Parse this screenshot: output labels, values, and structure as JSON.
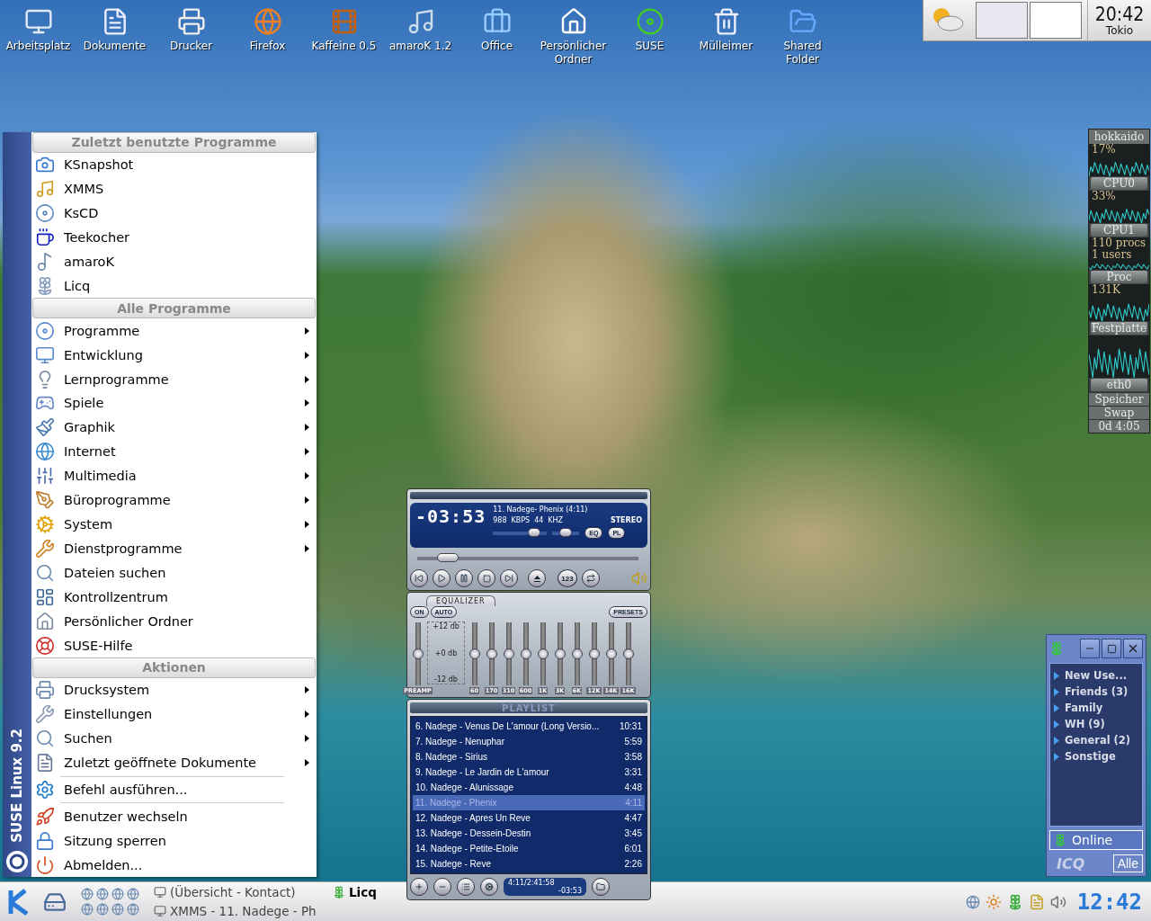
{
  "desktop_icons": [
    {
      "label": "Arbeitsplatz"
    },
    {
      "label": "Dokumente"
    },
    {
      "label": "Drucker"
    },
    {
      "label": "Firefox"
    },
    {
      "label": "Kaffeine 0.5"
    },
    {
      "label": "amaroK 1.2"
    },
    {
      "label": "Office"
    },
    {
      "label": "Persönlicher Ordner"
    },
    {
      "label": "SUSE"
    },
    {
      "label": "Mülleimer"
    },
    {
      "label": "Shared Folder"
    }
  ],
  "top_panel": {
    "time": "20:42",
    "city": "Tokio"
  },
  "kmenu": {
    "side_label": "SUSE Linux 9.2",
    "sections": [
      {
        "title": "Zuletzt benutzte Programme",
        "items": [
          {
            "label": "KSnapshot",
            "submenu": false,
            "separator_before": false
          },
          {
            "label": "XMMS",
            "submenu": false,
            "separator_before": false
          },
          {
            "label": "KsCD",
            "submenu": false,
            "separator_before": false
          },
          {
            "label": "Teekocher",
            "submenu": false,
            "separator_before": false
          },
          {
            "label": "amaroK",
            "submenu": false,
            "separator_before": false
          },
          {
            "label": "Licq",
            "submenu": false,
            "separator_before": false
          }
        ]
      },
      {
        "title": "Alle Programme",
        "items": [
          {
            "label": "Programme",
            "submenu": true,
            "separator_before": false
          },
          {
            "label": "Entwicklung",
            "submenu": true,
            "separator_before": false
          },
          {
            "label": "Lernprogramme",
            "submenu": true,
            "separator_before": false
          },
          {
            "label": "Spiele",
            "submenu": true,
            "separator_before": false
          },
          {
            "label": "Graphik",
            "submenu": true,
            "separator_before": false
          },
          {
            "label": "Internet",
            "submenu": true,
            "separator_before": false
          },
          {
            "label": "Multimedia",
            "submenu": true,
            "separator_before": false
          },
          {
            "label": "Büroprogramme",
            "submenu": true,
            "separator_before": false
          },
          {
            "label": "System",
            "submenu": true,
            "separator_before": false
          },
          {
            "label": "Dienstprogramme",
            "submenu": true,
            "separator_before": false
          },
          {
            "label": "Dateien suchen",
            "submenu": false,
            "separator_before": false
          },
          {
            "label": "Kontrollzentrum",
            "submenu": false,
            "separator_before": false
          },
          {
            "label": "Persönlicher Ordner",
            "submenu": false,
            "separator_before": false
          },
          {
            "label": "SUSE-Hilfe",
            "submenu": false,
            "separator_before": false
          }
        ]
      },
      {
        "title": "Aktionen",
        "items": [
          {
            "label": "Drucksystem",
            "submenu": true,
            "separator_before": false
          },
          {
            "label": "Einstellungen",
            "submenu": true,
            "separator_before": false
          },
          {
            "label": "Suchen",
            "submenu": true,
            "separator_before": false
          },
          {
            "label": "Zuletzt geöffnete Dokumente",
            "submenu": true,
            "separator_before": false
          },
          {
            "label": "Befehl ausführen...",
            "submenu": false,
            "separator_before": true
          },
          {
            "label": "Benutzer wechseln",
            "submenu": false,
            "separator_before": true
          },
          {
            "label": "Sitzung sperren",
            "submenu": false,
            "separator_before": false
          },
          {
            "label": "Abmelden...",
            "submenu": false,
            "separator_before": false
          }
        ]
      }
    ]
  },
  "system_monitor": {
    "host": "hokkaido",
    "panels": [
      {
        "reading": "17%",
        "label": "CPU0"
      },
      {
        "reading": "33%",
        "label": "CPU1"
      },
      {
        "reading": "110 procs",
        "reading_2": "1 users",
        "label": "Proc"
      },
      {
        "reading": "131K",
        "label": "Festplatte"
      },
      {
        "label": "eth0"
      }
    ],
    "memory": [
      "Speicher",
      "Swap"
    ],
    "uptime": "0d 4:05"
  },
  "xmms": {
    "time": "-03:53",
    "song": "11. Nadege- Phenix (4:11)",
    "kbps": "988",
    "kbps_unit": "KBPS",
    "khz": "44",
    "khz_unit": "KHZ",
    "channels": "STEREO",
    "eq_button": "EQ",
    "pl_button": "PL",
    "volume": {
      "level": 0.85
    },
    "balance": {
      "level": 0.5
    },
    "seek": {
      "level": 0.1
    },
    "shuffle_label": "123",
    "equalizer": {
      "title": "EQUALIZER",
      "on_button": "ON",
      "auto_button": "AUTO",
      "presets_button": "PRESETS",
      "scale": [
        "+12 db",
        "+0 db",
        "-12 db"
      ],
      "preamp": {
        "label": "PREAMP",
        "level": 0.5
      },
      "bands": [
        {
          "label": "60",
          "level": 0.5
        },
        {
          "label": "170",
          "level": 0.5
        },
        {
          "label": "310",
          "level": 0.5
        },
        {
          "label": "600",
          "level": 0.5
        },
        {
          "label": "1K",
          "level": 0.5
        },
        {
          "label": "3K",
          "level": 0.5
        },
        {
          "label": "6K",
          "level": 0.5
        },
        {
          "label": "12K",
          "level": 0.5
        },
        {
          "label": "14K",
          "level": 0.5
        },
        {
          "label": "16K",
          "level": 0.5
        }
      ]
    },
    "playlist": {
      "title": "PLAYLIST",
      "rows": [
        {
          "title": "6. Nadege - Venus De L'amour (Long Versio...",
          "length": "10:31",
          "selected": false
        },
        {
          "title": "7. Nadege - Nenuphar",
          "length": "5:59",
          "selected": false
        },
        {
          "title": "8. Nadege - Sirius",
          "length": "3:58",
          "selected": false
        },
        {
          "title": "9. Nadege - Le Jardin de L'amour",
          "length": "3:31",
          "selected": false
        },
        {
          "title": "10. Nadege - Alunissage",
          "length": "4:48",
          "selected": false
        },
        {
          "title": "11. Nadege - Phenix",
          "length": "4:11",
          "selected": true
        },
        {
          "title": "12. Nadege - Apres Un Reve",
          "length": "4:47",
          "selected": false
        },
        {
          "title": "13. Nadege - Dessein-Destin",
          "length": "3:45",
          "selected": false
        },
        {
          "title": "14. Nadege - Petite-Etoile",
          "length": "6:01",
          "selected": false
        },
        {
          "title": "15. Nadege - Reve",
          "length": "2:26",
          "selected": false
        }
      ],
      "total": "4:11/2:41:58",
      "remaining": "-03:53"
    }
  },
  "licq": {
    "groups": [
      {
        "label": "New Use..."
      },
      {
        "label": "Friends (3)"
      },
      {
        "label": "Family"
      },
      {
        "label": "WH (9)"
      },
      {
        "label": "General (2)"
      },
      {
        "label": "Sonstige"
      }
    ],
    "status": "Online",
    "logo": "ICQ",
    "filter_button": "Alle"
  },
  "taskbar": {
    "tasks": [
      {
        "label": "(Übersicht - Kontact)"
      },
      {
        "label": "Licq"
      },
      {
        "label": "XMMS - 11. Nadege - Ph"
      }
    ],
    "clock": "12:42"
  }
}
